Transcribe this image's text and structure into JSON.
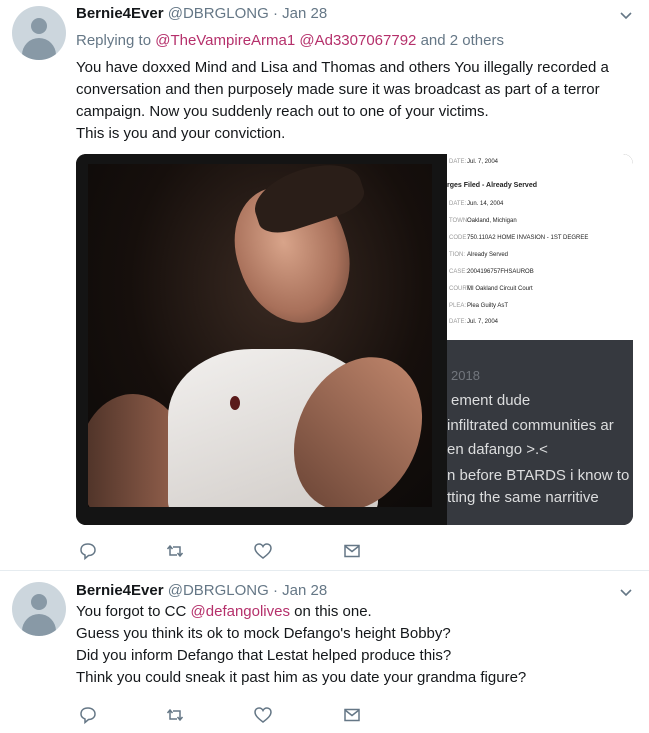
{
  "tweets": [
    {
      "name": "Bernie4Ever",
      "handle": "@DBRGLONG",
      "dot": "·",
      "date": "Jan 28",
      "reply": {
        "prefix": "Replying to",
        "mention1": "@TheVampireArma1",
        "mention2": "@Ad3307067792",
        "suffix": "and 2 others"
      },
      "lines": [
        "You have doxxed Mind and Lisa and Thomas and others You illegally recorded a",
        "conversation and then purposely made sure it was broadcast as part of a terror",
        "campaign. Now you suddenly reach out to one of your victims.",
        "This is you and your conviction."
      ],
      "document": [
        {
          "label": "DATE:",
          "value": "Jul. 7, 2004"
        },
        {
          "label": "",
          "value": "rges Filed - Already Served",
          "bold": true
        },
        {
          "label": "DATE:",
          "value": "Jun. 14, 2004"
        },
        {
          "label": "TOWN:",
          "value": "Oakland, Michigan"
        },
        {
          "label": "CODE:",
          "value": "750.110A2 HOME INVASION - 1ST DEGREE"
        },
        {
          "label": "TION:",
          "value": "Already Served"
        },
        {
          "label": "CASE:",
          "value": "2004196757FHSAUROB"
        },
        {
          "label": "COURT:",
          "value": "MI Oakland Circuit Court"
        },
        {
          "label": "PLEA:",
          "value": "Plea Guilty AsT"
        },
        {
          "label": "DATE:",
          "value": "Jul. 7, 2004"
        }
      ],
      "chat": {
        "date": "2018",
        "lines": [
          "ement dude",
          "infiltrated communities ar",
          "en dafango >.<",
          "n before BTARDS i know to",
          "tting the same narritive"
        ]
      }
    },
    {
      "name": "Bernie4Ever",
      "handle": "@DBRGLONG",
      "dot": "·",
      "date": "Jan 28",
      "line1_prefix": "You forgot to CC",
      "line1_mention": "@defangolives",
      "line1_suffix": "on this one.",
      "lines": [
        "Guess you think its ok to mock Defango's height Bobby?",
        "Did you inform Defango that Lestat helped produce this?",
        "Think you could sneak it past him as you date your grandma figure?"
      ]
    }
  ],
  "icons": [
    "reply-icon",
    "retweet-icon",
    "like-icon",
    "direct-message-icon",
    "chevron-down-icon",
    "avatar"
  ],
  "colors": {
    "mention": "#b5306b",
    "secondary": "#657786",
    "action_icon": "#657786",
    "chat_bg": "#36393f"
  }
}
